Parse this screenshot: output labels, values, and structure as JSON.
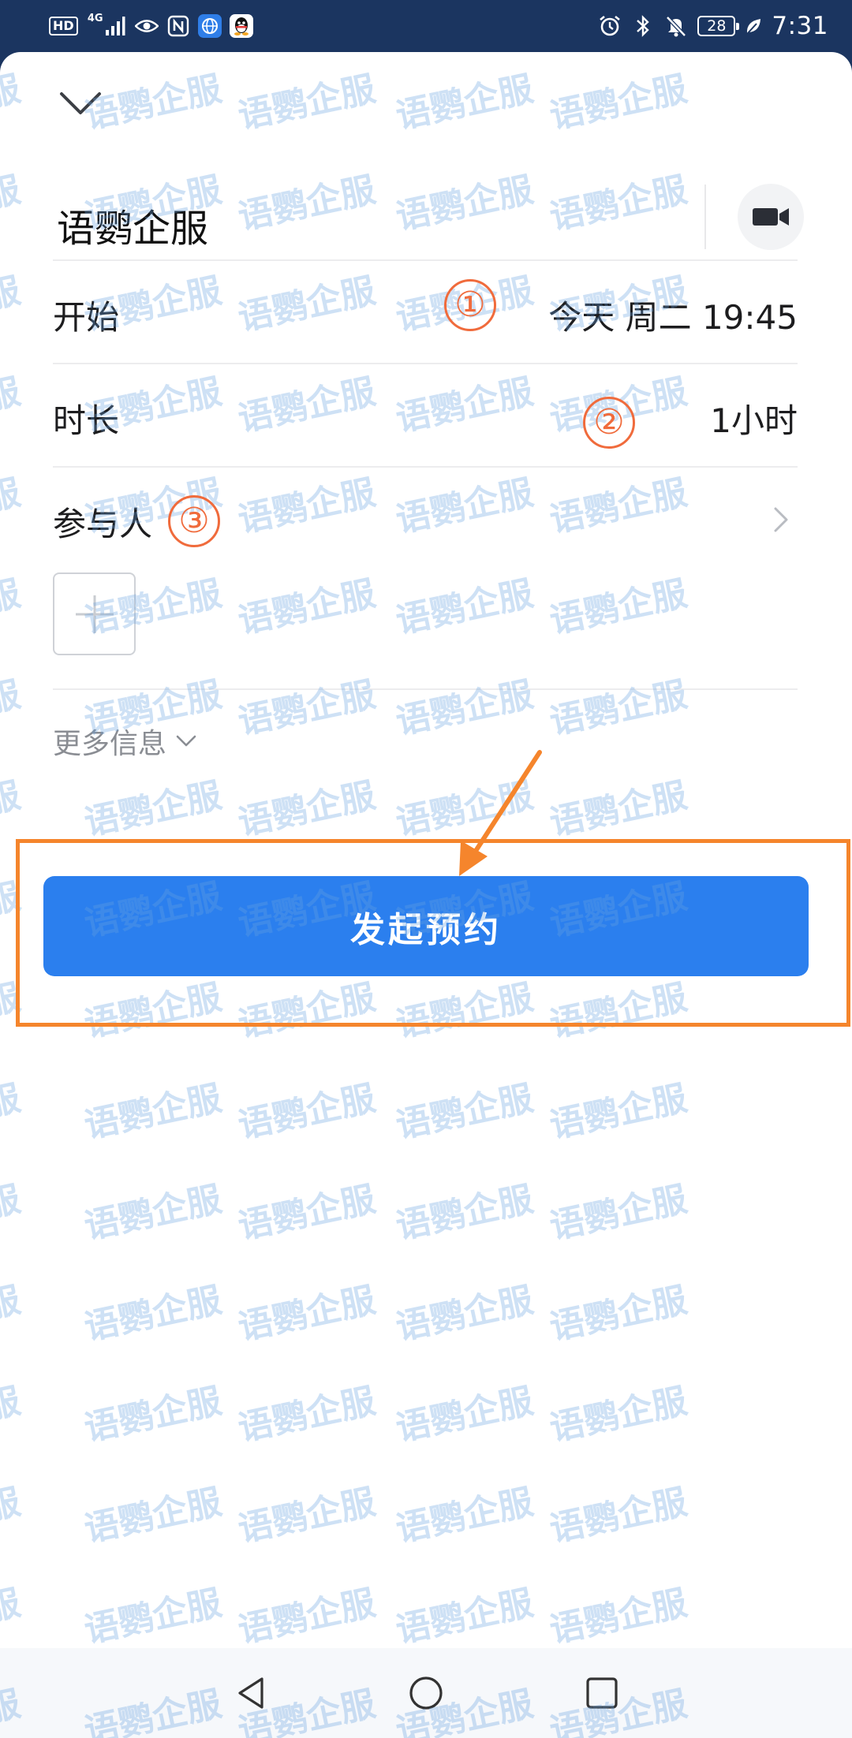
{
  "status_bar": {
    "hd_label": "HD",
    "network_label": "4G",
    "time": "7:31",
    "battery_level": "28",
    "left_icons": [
      "signal-icon",
      "eye-icon",
      "nfc-icon",
      "browser-icon",
      "qq-icon"
    ],
    "right_icons": [
      "alarm-icon",
      "bluetooth-icon",
      "mute-icon",
      "battery-icon",
      "leaf-icon"
    ]
  },
  "header": {
    "collapse_icon": "chevron-down-icon",
    "title": "语鹦企服",
    "video_icon": "video-camera-icon"
  },
  "form": {
    "start": {
      "label": "开始",
      "value": "今天 周二 19:45"
    },
    "duration": {
      "label": "时长",
      "value": "1小时"
    },
    "participants": {
      "label": "参与人",
      "chevron_icon": "chevron-right-icon",
      "add_icon": "plus-icon"
    },
    "more_info": {
      "label": "更多信息",
      "icon": "chevron-down-icon"
    }
  },
  "submit_button": {
    "label": "发起预约"
  },
  "annotations": {
    "markers": [
      "①",
      "②",
      "③"
    ],
    "highlight_color": "#f5852c",
    "marker_color": "#f06b3c"
  },
  "watermark": {
    "text": "语鹦企服"
  },
  "nav_bar": {
    "back_icon": "triangle-back-icon",
    "home_icon": "circle-home-icon",
    "recents_icon": "square-recents-icon"
  },
  "colors": {
    "status_bar_bg": "#1b3560",
    "primary": "#2b7fee",
    "text": "#1d1d1f",
    "secondary_text": "#8a8d93"
  }
}
